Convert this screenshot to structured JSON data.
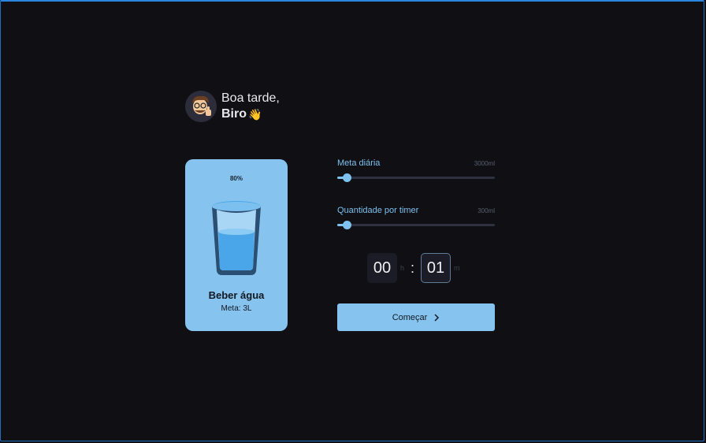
{
  "greeting": {
    "line1": "Boa tarde,",
    "name": "Biro",
    "wave": "👋"
  },
  "card": {
    "percent": "80%",
    "title": "Beber água",
    "subtitle": "Meta: 3L",
    "fill_fraction": 0.8
  },
  "sliders": [
    {
      "label": "Meta diária",
      "value": "3000ml",
      "fraction": 0.06
    },
    {
      "label": "Quantidade por timer",
      "value": "300ml",
      "fraction": 0.06
    }
  ],
  "timer": {
    "hours": "00",
    "hours_unit": "h",
    "separator": ":",
    "minutes": "01",
    "minutes_unit": "m"
  },
  "start_button": {
    "label": "Começar",
    "icon": "chevron-right-icon"
  },
  "colors": {
    "accent": "#86c3ef",
    "background": "#0f0f14",
    "water": "#4aa6e8"
  }
}
